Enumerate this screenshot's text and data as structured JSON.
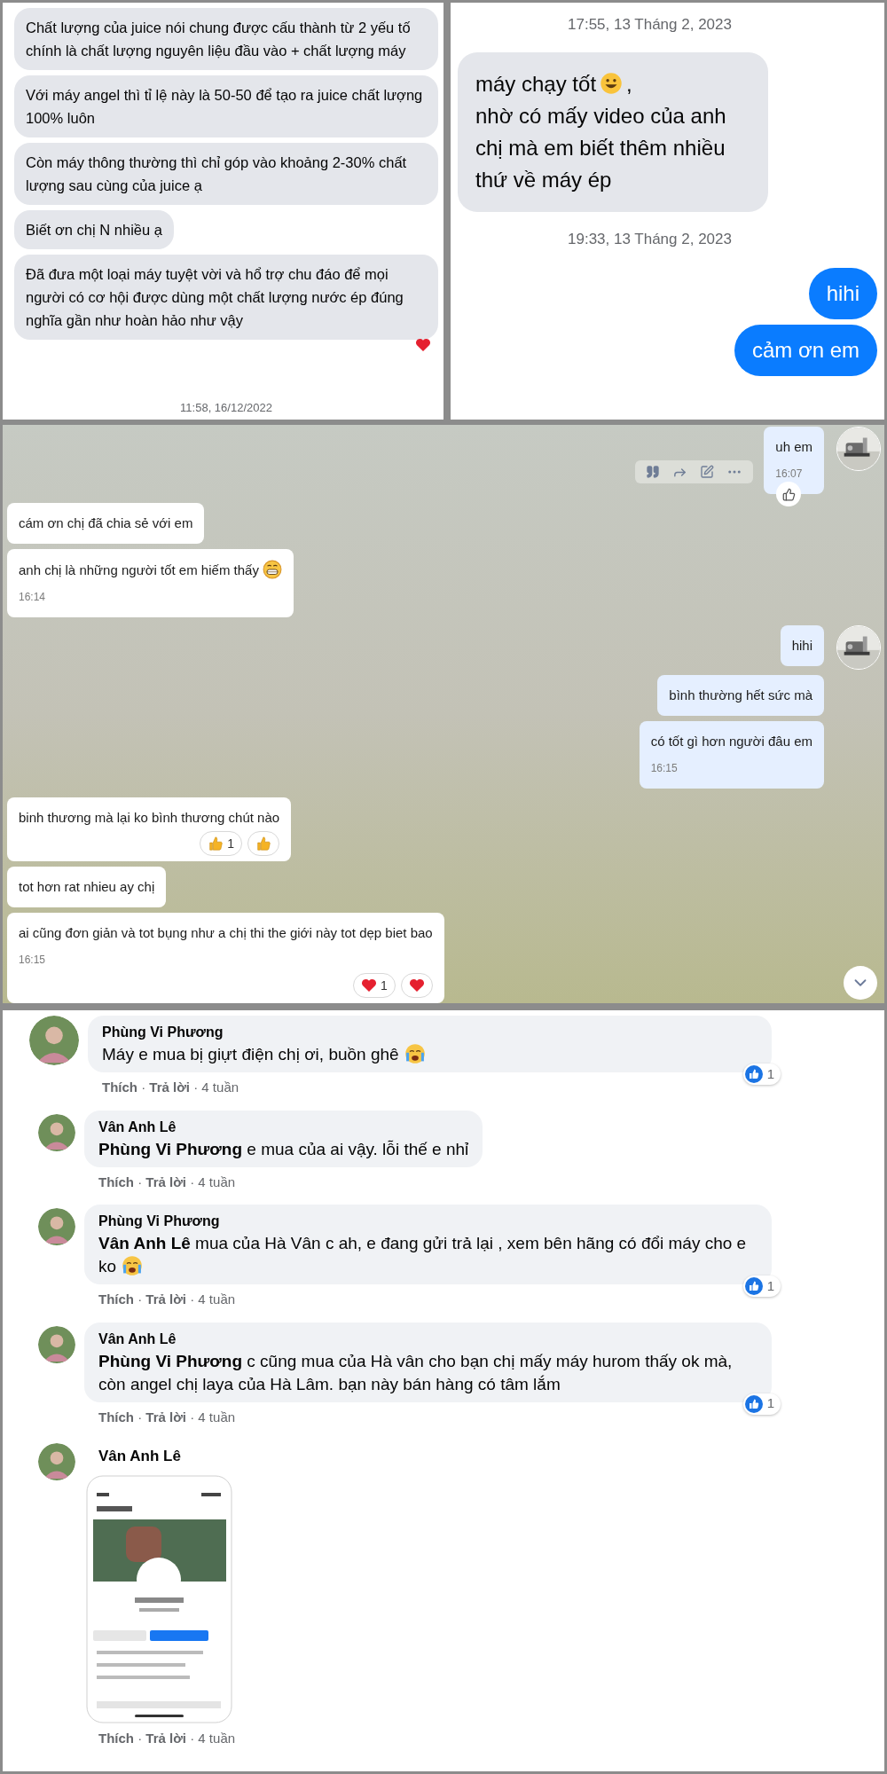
{
  "panel_1": {
    "messages": [
      {
        "text": "Chất lượng của juice nói chung được cấu thành từ 2 yếu tố chính là chất lượng nguyên liệu đầu vào + chất lượng máy"
      },
      {
        "text": "Với máy angel thì tỉ lệ này là 50-50 để tạo ra juice chất lượng 100% luôn"
      },
      {
        "text": "Còn máy thông thường thì chỉ góp vào khoảng 2-30% chất lượng sau cùng của juice ạ"
      },
      {
        "text": "Biết ơn chị N nhiều ạ"
      },
      {
        "text": "Đã đưa một loại máy tuyệt vời và hổ trợ chu đáo để mọi người có cơ hội được dùng một chất lượng nước ép đúng nghĩa gần như hoàn hảo như vậy",
        "hearted": true
      }
    ],
    "timestamp": "11:58, 16/12/2022"
  },
  "panel_2": {
    "items": [
      {
        "kind": "timestamp",
        "text": "17:55, 13 Tháng 2, 2023"
      },
      {
        "kind": "received",
        "text": "máy chạy tốt",
        "emoji": {
          "kind": "smile"
        },
        "text_after": ",\nnhờ có mấy video của anh chị mà em biết thêm nhiều thứ về máy ép"
      },
      {
        "kind": "timestamp",
        "text": "19:33, 13 Tháng 2, 2023"
      },
      {
        "kind": "sent",
        "text": "hihi"
      },
      {
        "kind": "sent",
        "text": "cảm ơn em"
      }
    ]
  },
  "panel_3": {
    "groups": [
      {
        "kind": "out",
        "messages": [
          {
            "text": "uh em",
            "time": "16:07",
            "reactions": [
              {
                "kind": "like-outline"
              }
            ]
          }
        ]
      },
      {
        "kind": "in",
        "messages": [
          {
            "text": "cám ơn chị đã chia sẻ với em"
          },
          {
            "text": "anh chị là những người tốt em hiếm thấy",
            "emoji": {
              "kind": "grin"
            },
            "time": "16:14"
          }
        ]
      },
      {
        "kind": "out",
        "messages": [
          {
            "text": "hihi"
          },
          {
            "text": "bình thường hết sức mà"
          },
          {
            "text": "có tốt gì hơn người đâu em",
            "time": "16:15"
          }
        ]
      },
      {
        "kind": "in",
        "messages": [
          {
            "text": "binh thương mà lại ko bình thương chút nào",
            "reactions": [
              {
                "kind": "like",
                "count": "1"
              },
              {
                "kind": "like"
              }
            ]
          },
          {
            "text": "tot hơn rat nhieu ay chị"
          },
          {
            "text": "ai cũng đơn giản và tot bụng như a chị thi the giới này tot dẹp biet bao",
            "time": "16:15",
            "reactions": [
              {
                "kind": "heart",
                "count": "1"
              },
              {
                "kind": "heart"
              }
            ]
          }
        ]
      }
    ]
  },
  "panel_4": {
    "comments": [
      {
        "kind": "text",
        "author": "Phùng Vi Phương",
        "text": "Máy e mua bị giựt điện chị ơi, buồn ghê",
        "emoji": {
          "kind": "crying"
        },
        "likes": "1",
        "meta": "**Thích** · **Trả lời** · 4 tuần",
        "replies": [
          {
            "kind": "text",
            "author": "Vân Anh Lê",
            "text": "**Phùng Vi Phương** e mua của ai vậy. lỗi thế e nhỉ",
            "meta": "**Thích** · **Trả lời** · 4 tuần"
          },
          {
            "kind": "text",
            "author": "Phùng Vi Phương",
            "text": "**Vân Anh Lê** mua của Hà Vân c ah, e đang gửi trả lại , xem bên hãng có đổi máy cho e ko",
            "emoji": {
              "kind": "crying"
            },
            "likes": "1",
            "meta": "**Thích** · **Trả lời** · 4 tuần"
          },
          {
            "kind": "text",
            "author": "Vân Anh Lê",
            "text": "**Phùng Vi Phương** c cũng mua của Hà vân cho bạn chị mấy máy hurom thấy ok mà, còn angel chị laya của Hà Lâm. bạn này bán hàng có tâm lắm",
            "likes": "1",
            "meta": "**Thích** · **Trả lời** · 4 tuần"
          },
          {
            "author": "Vân Anh Lê",
            "meta": "**Thích** · **Trả lời** · 4 tuần"
          }
        ]
      }
    ]
  }
}
